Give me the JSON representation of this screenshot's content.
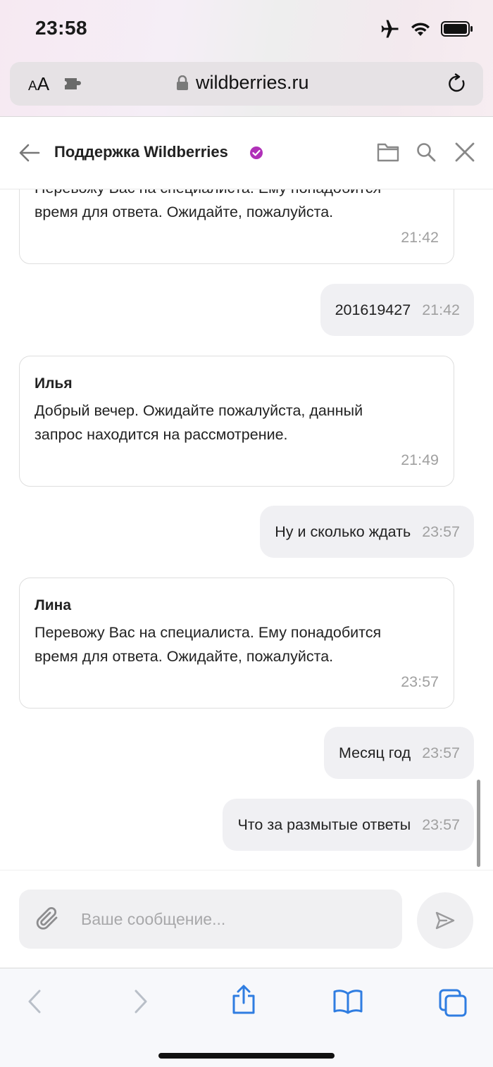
{
  "status_bar": {
    "time": "23:58",
    "icons": [
      "airplane-icon",
      "wifi-icon",
      "battery-icon"
    ]
  },
  "browser": {
    "text_size_label_small": "A",
    "text_size_label_large": "A",
    "url": "wildberries.ru"
  },
  "chat": {
    "title": "Поддержка Wildberries",
    "verified_color": "#b031b8",
    "messages": [
      {
        "direction": "in",
        "author": "",
        "text": "Перевожу Вас на специалиста. Ему понадобится время для ответа. Ожидайте, пожалуйста.",
        "time": "21:42"
      },
      {
        "direction": "out",
        "text": "201619427",
        "time": "21:42"
      },
      {
        "direction": "in",
        "author": "Илья",
        "text": "Добрый вечер. Ожидайте пожалуйста, данный запрос находится на рассмотрение.",
        "time": "21:49"
      },
      {
        "direction": "out",
        "text": "Ну и сколько ждать",
        "time": "23:57"
      },
      {
        "direction": "in",
        "author": "Лина",
        "text": "Перевожу Вас на специалиста. Ему понадобится время для ответа. Ожидайте, пожалуйста.",
        "time": "23:57"
      },
      {
        "direction": "out",
        "text": "Месяц год",
        "time": "23:57"
      },
      {
        "direction": "out",
        "text": "Что за размытые ответы",
        "time": "23:57"
      }
    ]
  },
  "composer": {
    "placeholder": "Ваше сообщение...",
    "value": ""
  },
  "colors": {
    "accent_blue": "#2f7de1",
    "bubble_out": "#f0f0f3",
    "time_gray": "#a0a0a0"
  }
}
